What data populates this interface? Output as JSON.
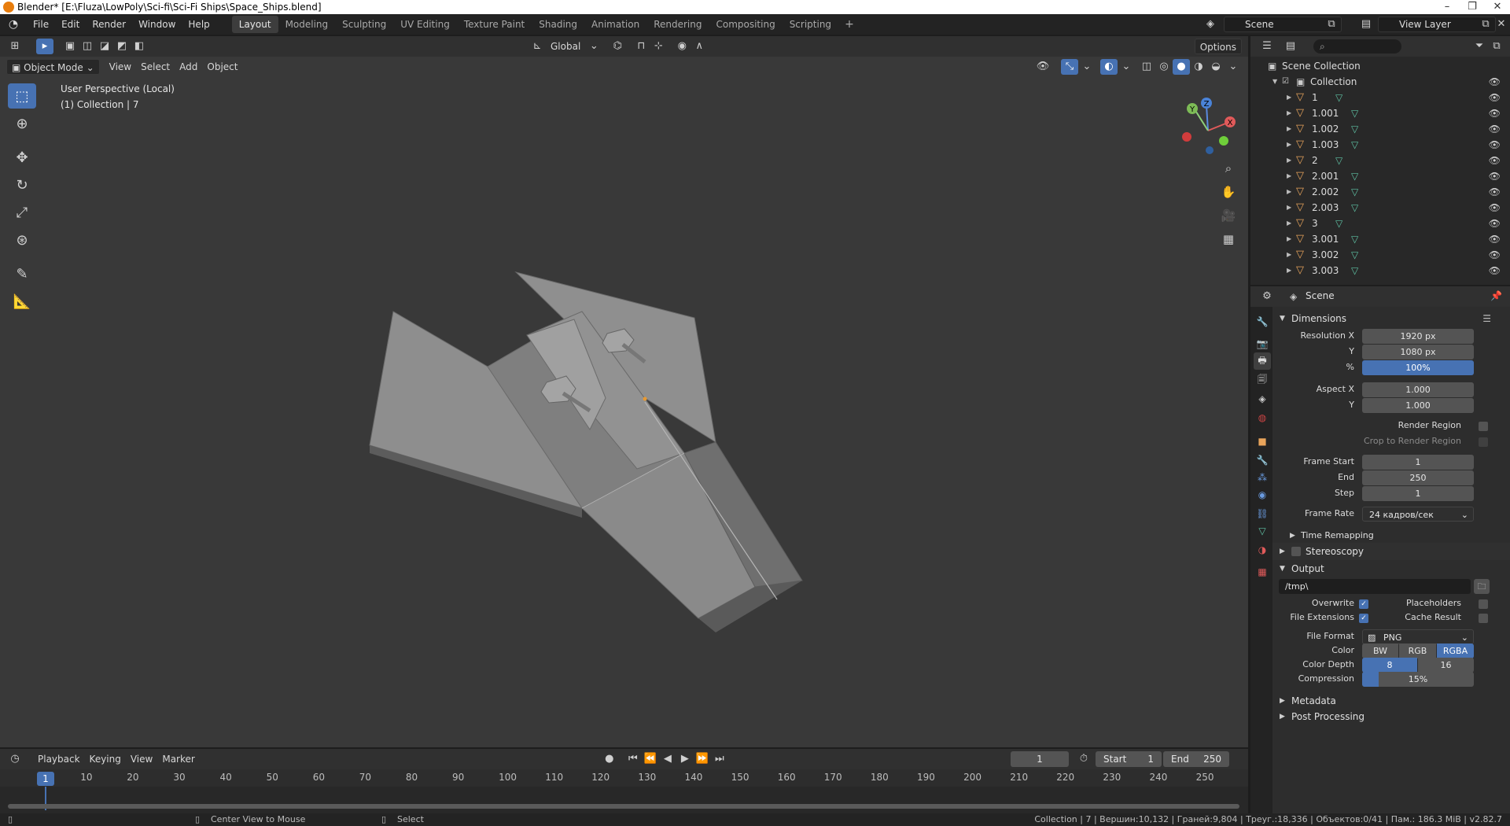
{
  "window": {
    "title": "Blender* [E:\\Fluza\\LowPoly\\Sci-fi\\Sci-Fi Ships\\Space_Ships.blend]"
  },
  "menu": [
    "File",
    "Edit",
    "Render",
    "Window",
    "Help"
  ],
  "workspaces": [
    "Layout",
    "Modeling",
    "Sculpting",
    "UV Editing",
    "Texture Paint",
    "Shading",
    "Animation",
    "Rendering",
    "Compositing",
    "Scripting"
  ],
  "active_workspace": "Layout",
  "scene_name": "Scene",
  "view_layer": "View Layer",
  "viewport": {
    "transform_orientation": "Global",
    "options_label": "Options",
    "mode": "Object Mode",
    "menus": [
      "View",
      "Select",
      "Add",
      "Object"
    ],
    "perspective_text": "User Perspective (Local)",
    "collection_text": "(1) Collection | 7",
    "gizmo_axes": {
      "x": "X",
      "y": "Y",
      "z": "Z"
    }
  },
  "timeline": {
    "menus": [
      "Playback",
      "Keying",
      "View",
      "Marker"
    ],
    "current_frame": "1",
    "start_label": "Start",
    "start": "1",
    "end_label": "End",
    "end": "250",
    "ticks": [
      "10",
      "20",
      "30",
      "40",
      "50",
      "60",
      "70",
      "80",
      "90",
      "100",
      "110",
      "120",
      "130",
      "140",
      "150",
      "160",
      "170",
      "180",
      "190",
      "200",
      "210",
      "220",
      "230",
      "240",
      "250"
    ]
  },
  "statusbar": {
    "hint1": "Center View to Mouse",
    "hint2": "Select",
    "stats": "Collection | 7 | Вершин:10,132 | Граней:9,804 | Треуг.:18,336 | Объектов:0/41 | Пам.: 186.3 MiB | v2.82.7"
  },
  "outliner": {
    "root": "Scene Collection",
    "collection": "Collection",
    "items": [
      "1",
      "1.001",
      "1.002",
      "1.003",
      "2",
      "2.001",
      "2.002",
      "2.003",
      "3",
      "3.001",
      "3.002",
      "3.003"
    ]
  },
  "properties": {
    "context": "Scene",
    "dimensions": {
      "title": "Dimensions",
      "resolution_x_label": "Resolution X",
      "resolution_x": "1920 px",
      "resolution_y_label": "Y",
      "resolution_y": "1080 px",
      "percent_label": "%",
      "percent": "100%",
      "aspect_x_label": "Aspect X",
      "aspect_x": "1.000",
      "aspect_y_label": "Y",
      "aspect_y": "1.000",
      "render_region": "Render Region",
      "crop_region": "Crop to Render Region",
      "frame_start_label": "Frame Start",
      "frame_start": "1",
      "end_label": "End",
      "end": "250",
      "step_label": "Step",
      "step": "1",
      "frame_rate_label": "Frame Rate",
      "frame_rate": "24 кадров/сек",
      "time_remapping": "Time Remapping"
    },
    "stereoscopy": "Stereoscopy",
    "output": {
      "title": "Output",
      "path": "/tmp\\",
      "overwrite": "Overwrite",
      "placeholders": "Placeholders",
      "file_extensions": "File Extensions",
      "cache_result": "Cache Result",
      "file_format_label": "File Format",
      "file_format": "PNG",
      "color_label": "Color",
      "color_bw": "BW",
      "color_rgb": "RGB",
      "color_rgba": "RGBA",
      "depth_label": "Color Depth",
      "depth_8": "8",
      "depth_16": "16",
      "compression_label": "Compression",
      "compression": "15%"
    },
    "metadata": "Metadata",
    "post_processing": "Post Processing"
  }
}
